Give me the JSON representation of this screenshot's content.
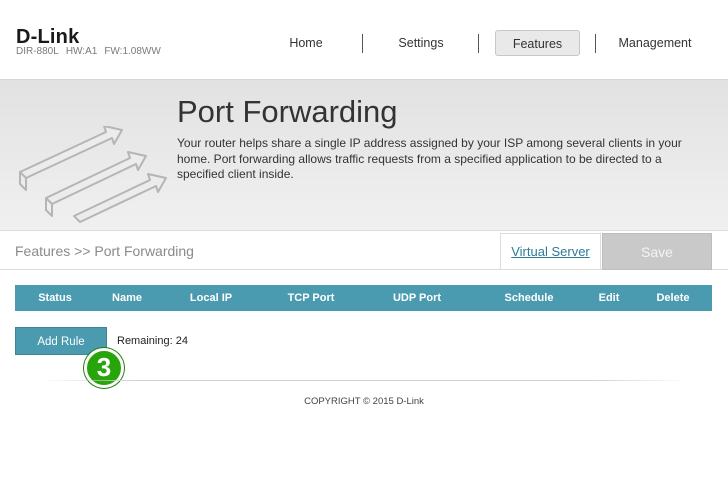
{
  "header": {
    "logo": "D-Link",
    "model": "DIR-880L",
    "hw": "HW:A1",
    "fw": "FW:1.08WW",
    "nav": {
      "home": "Home",
      "settings": "Settings",
      "features": "Features",
      "management": "Management"
    },
    "active_nav": "Features"
  },
  "banner": {
    "title": "Port Forwarding",
    "description": "Your router helps share a single IP address assigned by your ISP among several clients in your home. Port forwarding allows traffic requests from a specified application to be directed to a specified client inside.",
    "icon": "port-forwarding-arrows-icon"
  },
  "toolbar": {
    "breadcrumb": "Features >> Port Forwarding",
    "virtual_server_label": "Virtual Server",
    "save_label": "Save"
  },
  "table": {
    "columns": {
      "status": "Status",
      "name": "Name",
      "local_ip": "Local IP",
      "tcp_port": "TCP Port",
      "udp_port": "UDP Port",
      "schedule": "Schedule",
      "edit": "Edit",
      "delete": "Delete"
    },
    "rows": []
  },
  "actions": {
    "add_rule_label": "Add Rule",
    "remaining": "Remaining: 24",
    "step_badge": "3"
  },
  "footer": {
    "copyright": "COPYRIGHT © 2015 D-Link"
  },
  "colors": {
    "accent": "#4a9bb0",
    "save_disabled": "#c9c9c9",
    "step_badge": "#29a50c",
    "link": "#2f7a97"
  }
}
